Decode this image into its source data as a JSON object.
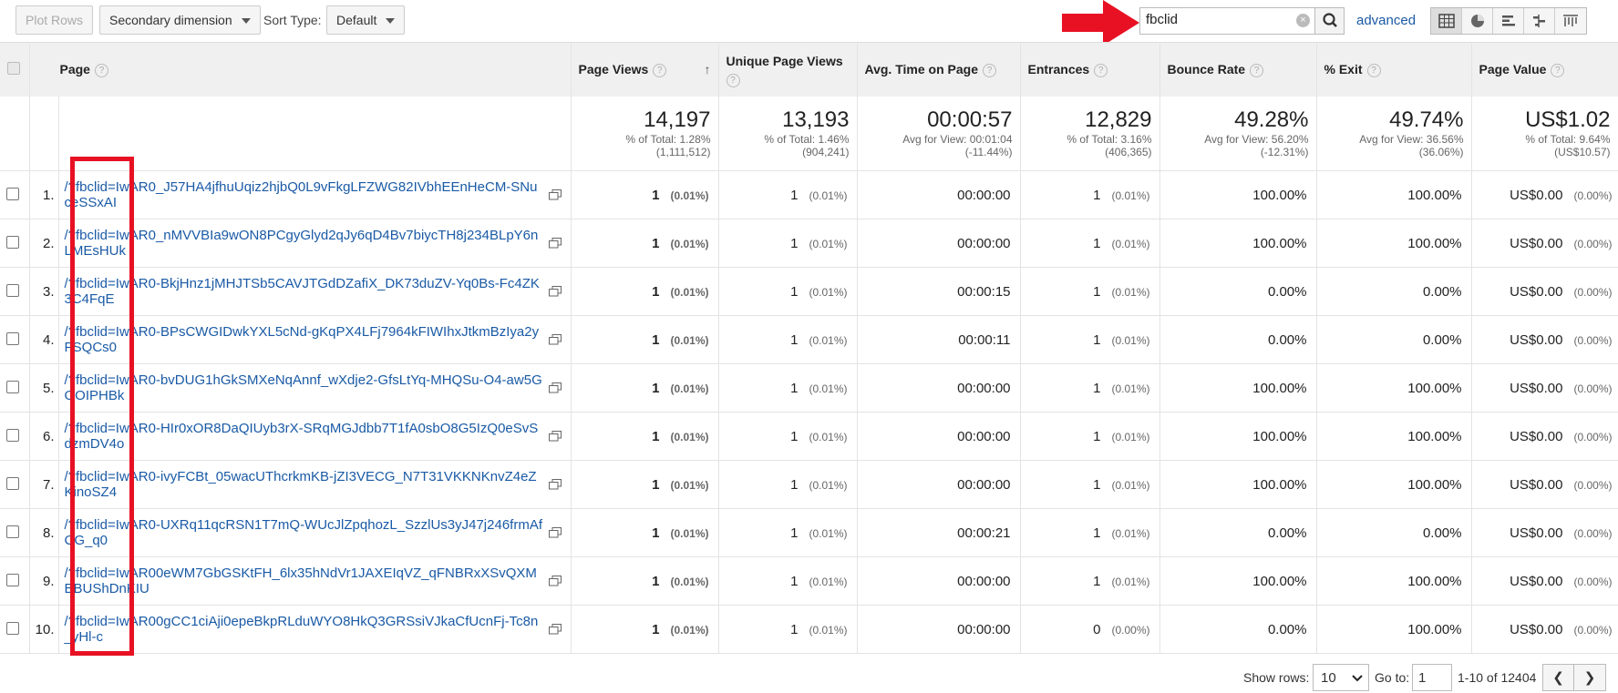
{
  "toolbar": {
    "plot_rows": "Plot Rows",
    "secondary_dimension": "Secondary dimension",
    "sort_type_label": "Sort Type:",
    "sort_type_value": "Default",
    "search_value": "fbclid",
    "advanced": "advanced",
    "views": [
      "table-view-icon",
      "pie-view-icon",
      "performance-view-icon",
      "comparison-view-icon",
      "pivot-view-icon"
    ]
  },
  "columns": {
    "page": "Page",
    "page_views": "Page Views",
    "unique_page_views": "Unique Page Views",
    "avg_time": "Avg. Time on Page",
    "entrances": "Entrances",
    "bounce_rate": "Bounce Rate",
    "exit": "% Exit",
    "page_value": "Page Value"
  },
  "totals": {
    "page_views": {
      "value": "14,197",
      "line1": "% of Total: 1.28%",
      "line2": "(1,111,512)"
    },
    "unique_page_views": {
      "value": "13,193",
      "line1": "% of Total: 1.46%",
      "line2": "(904,241)"
    },
    "avg_time": {
      "value": "00:00:57",
      "line1": "Avg for View: 00:01:04",
      "line2": "(-11.44%)"
    },
    "entrances": {
      "value": "12,829",
      "line1": "% of Total: 3.16%",
      "line2": "(406,365)"
    },
    "bounce_rate": {
      "value": "49.28%",
      "line1": "Avg for View: 56.20%",
      "line2": "(-12.31%)"
    },
    "exit": {
      "value": "49.74%",
      "line1": "Avg for View: 36.56%",
      "line2": "(36.06%)"
    },
    "page_value": {
      "value": "US$1.02",
      "line1": "% of Total: 9.64%",
      "line2": "(US$10.57)"
    }
  },
  "rows": [
    {
      "rank": "1.",
      "page": "/?fbclid=IwAR0_J57HA4jfhuUqiz2hjbQ0L9vFkgLFZWG82IVbhEEnHeCM-SNuceSSxAI",
      "pv": "1",
      "pv_pct": "(0.01%)",
      "upv": "1",
      "upv_pct": "(0.01%)",
      "time": "00:00:00",
      "ent": "1",
      "ent_pct": "(0.01%)",
      "bounce": "100.00%",
      "exit": "100.00%",
      "value": "US$0.00",
      "value_pct": "(0.00%)"
    },
    {
      "rank": "2.",
      "page": "/?fbclid=IwAR0_nMVVBIa9wON8PCgyGlyd2qJy6qD4Bv7biycTH8j234BLpY6nLMEsHUk",
      "pv": "1",
      "pv_pct": "(0.01%)",
      "upv": "1",
      "upv_pct": "(0.01%)",
      "time": "00:00:00",
      "ent": "1",
      "ent_pct": "(0.01%)",
      "bounce": "100.00%",
      "exit": "100.00%",
      "value": "US$0.00",
      "value_pct": "(0.00%)"
    },
    {
      "rank": "3.",
      "page": "/?fbclid=IwAR0-BkjHnz1jMHJTSb5CAVJTGdDZafiX_DK73duZV-Yq0Bs-Fc4ZK3C4FqE",
      "pv": "1",
      "pv_pct": "(0.01%)",
      "upv": "1",
      "upv_pct": "(0.01%)",
      "time": "00:00:15",
      "ent": "1",
      "ent_pct": "(0.01%)",
      "bounce": "0.00%",
      "exit": "0.00%",
      "value": "US$0.00",
      "value_pct": "(0.00%)"
    },
    {
      "rank": "4.",
      "page": "/?fbclid=IwAR0-BPsCWGIDwkYXL5cNd-gKqPX4LFj7964kFIWIhxJtkmBzIya2yFSQCs0",
      "pv": "1",
      "pv_pct": "(0.01%)",
      "upv": "1",
      "upv_pct": "(0.01%)",
      "time": "00:00:11",
      "ent": "1",
      "ent_pct": "(0.01%)",
      "bounce": "0.00%",
      "exit": "0.00%",
      "value": "US$0.00",
      "value_pct": "(0.00%)"
    },
    {
      "rank": "5.",
      "page": "/?fbclid=IwAR0-bvDUG1hGkSMXeNqAnnf_wXdje2-GfsLtYq-MHQSu-O4-aw5GOOIPHBk",
      "pv": "1",
      "pv_pct": "(0.01%)",
      "upv": "1",
      "upv_pct": "(0.01%)",
      "time": "00:00:00",
      "ent": "1",
      "ent_pct": "(0.01%)",
      "bounce": "100.00%",
      "exit": "100.00%",
      "value": "US$0.00",
      "value_pct": "(0.00%)"
    },
    {
      "rank": "6.",
      "page": "/?fbclid=IwAR0-HIr0xOR8DaQIUyb3rX-SRqMGJdbb7T1fA0sbO8G5IzQ0eSvSdzmDV4o",
      "pv": "1",
      "pv_pct": "(0.01%)",
      "upv": "1",
      "upv_pct": "(0.01%)",
      "time": "00:00:00",
      "ent": "1",
      "ent_pct": "(0.01%)",
      "bounce": "100.00%",
      "exit": "100.00%",
      "value": "US$0.00",
      "value_pct": "(0.00%)"
    },
    {
      "rank": "7.",
      "page": "/?fbclid=IwAR0-ivyFCBt_05wacUThcrkmKB-jZI3VECG_N7T31VKKNKnvZ4eZKinoSZ4",
      "pv": "1",
      "pv_pct": "(0.01%)",
      "upv": "1",
      "upv_pct": "(0.01%)",
      "time": "00:00:00",
      "ent": "1",
      "ent_pct": "(0.01%)",
      "bounce": "100.00%",
      "exit": "100.00%",
      "value": "US$0.00",
      "value_pct": "(0.00%)"
    },
    {
      "rank": "8.",
      "page": "/?fbclid=IwAR0-UXRq11qcRSN1T7mQ-WUcJlZpqhozL_SzzlUs3yJ47j246frmAfCG_q0",
      "pv": "1",
      "pv_pct": "(0.01%)",
      "upv": "1",
      "upv_pct": "(0.01%)",
      "time": "00:00:21",
      "ent": "1",
      "ent_pct": "(0.01%)",
      "bounce": "0.00%",
      "exit": "0.00%",
      "value": "US$0.00",
      "value_pct": "(0.00%)"
    },
    {
      "rank": "9.",
      "page": "/?fbclid=IwAR00eWM7GbGSKtFH_6lx35hNdVr1JAXEIqVZ_qFNBRxXSvQXMBBUShDnKIU",
      "pv": "1",
      "pv_pct": "(0.01%)",
      "upv": "1",
      "upv_pct": "(0.01%)",
      "time": "00:00:00",
      "ent": "1",
      "ent_pct": "(0.01%)",
      "bounce": "100.00%",
      "exit": "100.00%",
      "value": "US$0.00",
      "value_pct": "(0.00%)"
    },
    {
      "rank": "10.",
      "page": "/?fbclid=IwAR00gCC1ciAji0epeBkpRLduWYO8HkQ3GRSsiVJkaCfUcnFj-Tc8n_yHl-c",
      "pv": "1",
      "pv_pct": "(0.01%)",
      "upv": "1",
      "upv_pct": "(0.01%)",
      "time": "00:00:00",
      "ent": "0",
      "ent_pct": "(0.00%)",
      "bounce": "0.00%",
      "exit": "100.00%",
      "value": "US$0.00",
      "value_pct": "(0.00%)"
    }
  ],
  "footer": {
    "show_rows_label": "Show rows:",
    "show_rows_value": "10",
    "goto_label": "Go to:",
    "goto_value": "1",
    "range": "1-10 of 12404"
  },
  "colors": {
    "link": "#1a5aa6",
    "annotation": "#e81123"
  }
}
